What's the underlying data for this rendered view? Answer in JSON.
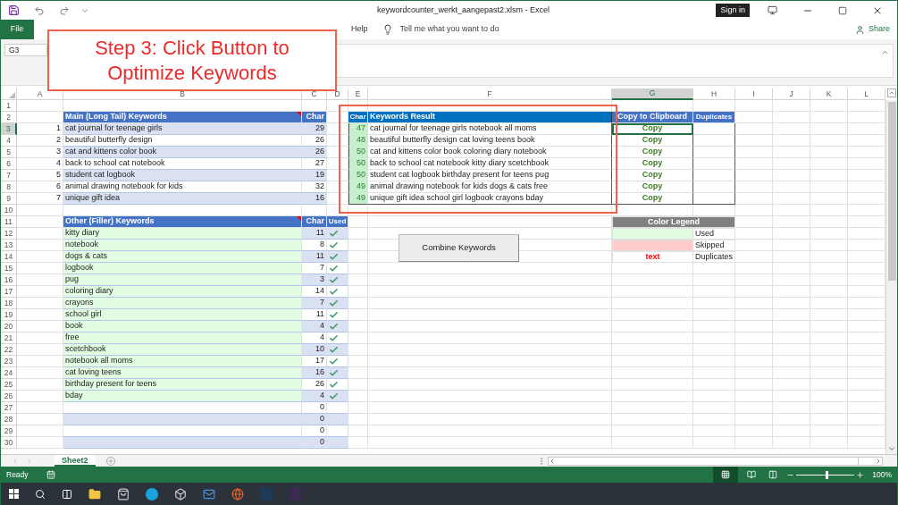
{
  "window": {
    "title": "keywordcounter_werkt_aangepast2.xlsm  -  Excel",
    "sign_in": "Sign in"
  },
  "ribbon": {
    "file_tab": "File",
    "tabs": [
      "Help"
    ],
    "tell_me": "Tell me what you want to do",
    "share": "Share"
  },
  "name_box": "G3",
  "annotation": {
    "lines": [
      "Step 3: Click Button to",
      "Optimize Keywords"
    ]
  },
  "column_headers": [
    {
      "label": "A",
      "selected": false
    },
    {
      "label": "B",
      "selected": false
    },
    {
      "label": "C",
      "selected": false
    },
    {
      "label": "D",
      "selected": false
    },
    {
      "label": "E",
      "selected": false
    },
    {
      "label": "F",
      "selected": false
    },
    {
      "label": "G",
      "selected": true
    },
    {
      "label": "H",
      "selected": false
    },
    {
      "label": "I",
      "selected": false
    },
    {
      "label": "J",
      "selected": false
    },
    {
      "label": "K",
      "selected": false
    },
    {
      "label": "L",
      "selected": false
    }
  ],
  "row_headers": [
    {
      "label": "1",
      "selected": false
    },
    {
      "label": "2",
      "selected": false
    },
    {
      "label": "3",
      "selected": true
    },
    {
      "label": "4",
      "selected": false
    },
    {
      "label": "5",
      "selected": false
    },
    {
      "label": "6",
      "selected": false
    },
    {
      "label": "7",
      "selected": false
    },
    {
      "label": "8",
      "selected": false
    },
    {
      "label": "9",
      "selected": false
    },
    {
      "label": "10",
      "selected": false
    },
    {
      "label": "11",
      "selected": false
    },
    {
      "label": "12",
      "selected": false
    },
    {
      "label": "13",
      "selected": false
    },
    {
      "label": "14",
      "selected": false
    },
    {
      "label": "15",
      "selected": false
    },
    {
      "label": "16",
      "selected": false
    },
    {
      "label": "17",
      "selected": false
    },
    {
      "label": "18",
      "selected": false
    },
    {
      "label": "19",
      "selected": false
    },
    {
      "label": "20",
      "selected": false
    },
    {
      "label": "21",
      "selected": false
    },
    {
      "label": "22",
      "selected": false
    },
    {
      "label": "23",
      "selected": false
    },
    {
      "label": "24",
      "selected": false
    },
    {
      "label": "25",
      "selected": false
    },
    {
      "label": "26",
      "selected": false
    },
    {
      "label": "27",
      "selected": false
    },
    {
      "label": "28",
      "selected": false
    },
    {
      "label": "29",
      "selected": false
    },
    {
      "label": "30",
      "selected": false
    }
  ],
  "main_keywords": {
    "title": "Main (Long Tail) Keywords",
    "char_header": "Char",
    "rows": [
      {
        "number": "1",
        "keyword": "cat journal for teenage girls",
        "char": "29"
      },
      {
        "number": "2",
        "keyword": "beautiful butterfly design",
        "char": "26"
      },
      {
        "number": "3",
        "keyword": "cat and kittens color book",
        "char": "26"
      },
      {
        "number": "4",
        "keyword": "back to school cat notebook",
        "char": "27"
      },
      {
        "number": "5",
        "keyword": "student cat logbook",
        "char": "19"
      },
      {
        "number": "6",
        "keyword": "animal drawing notebook for kids",
        "char": "32"
      },
      {
        "number": "7",
        "keyword": "unique gift idea",
        "char": "16"
      }
    ]
  },
  "results": {
    "char_header": "Char",
    "title": "Keywords Result",
    "copy_header": "Copy to Clipboard",
    "duplicates_header": "Duplicates",
    "rows": [
      {
        "char": "47",
        "text": "cat journal for teenage girls notebook all moms",
        "copy": "Copy",
        "selected": true
      },
      {
        "char": "48",
        "text": "beautiful butterfly design cat loving teens book",
        "copy": "Copy",
        "selected": false
      },
      {
        "char": "50",
        "text": "cat and kittens color book coloring diary notebook",
        "copy": "Copy",
        "selected": false
      },
      {
        "char": "50",
        "text": "back to school cat notebook kitty diary scetchbook",
        "copy": "Copy",
        "selected": false
      },
      {
        "char": "50",
        "text": "student cat logbook birthday present for teens pug",
        "copy": "Copy",
        "selected": false
      },
      {
        "char": "49",
        "text": "animal drawing notebook for kids dogs & cats free",
        "copy": "Copy",
        "selected": false
      },
      {
        "char": "49",
        "text": "unique gift idea school girl logbook crayons bday",
        "copy": "Copy",
        "selected": false
      }
    ]
  },
  "filler": {
    "title": "Other (Filler) Keywords",
    "char_header": "Char",
    "used_header": "Used",
    "rows": [
      {
        "keyword": "kitty diary",
        "char": "11",
        "used": true
      },
      {
        "keyword": "notebook",
        "char": "8",
        "used": true
      },
      {
        "keyword": "dogs & cats",
        "char": "11",
        "used": true
      },
      {
        "keyword": "logbook",
        "char": "7",
        "used": true
      },
      {
        "keyword": "pug",
        "char": "3",
        "used": true
      },
      {
        "keyword": "coloring diary",
        "char": "14",
        "used": true
      },
      {
        "keyword": "crayons",
        "char": "7",
        "used": true
      },
      {
        "keyword": "school girl",
        "char": "11",
        "used": true
      },
      {
        "keyword": "book",
        "char": "4",
        "used": true
      },
      {
        "keyword": "free",
        "char": "4",
        "used": true
      },
      {
        "keyword": "scetchbook",
        "char": "10",
        "used": true
      },
      {
        "keyword": "notebook all moms",
        "char": "17",
        "used": true
      },
      {
        "keyword": "cat loving teens",
        "char": "16",
        "used": true
      },
      {
        "keyword": "birthday present for teens",
        "char": "26",
        "used": true
      },
      {
        "keyword": "bday",
        "char": "4",
        "used": true
      },
      {
        "char": "0",
        "used": false
      },
      {
        "char": "0",
        "used": false
      },
      {
        "char": "0",
        "used": false
      },
      {
        "char": "0",
        "used": false
      }
    ]
  },
  "combine_button": "Combine  Keywords",
  "legend": {
    "title": "Color Legend",
    "items": [
      {
        "kind": "fill",
        "color": "#e2fce2",
        "label": "Used"
      },
      {
        "kind": "fill",
        "color": "#ffcccc",
        "label": "Skipped"
      },
      {
        "kind": "text",
        "sample": "text",
        "color": "#ff0000",
        "label": "Duplicates"
      }
    ]
  },
  "sheet_tabs": [
    {
      "label": "Sheet2",
      "selected": true
    }
  ],
  "status": {
    "text": "Ready",
    "zoom": "100%"
  },
  "zoom_slider": {
    "level": 0.5
  }
}
